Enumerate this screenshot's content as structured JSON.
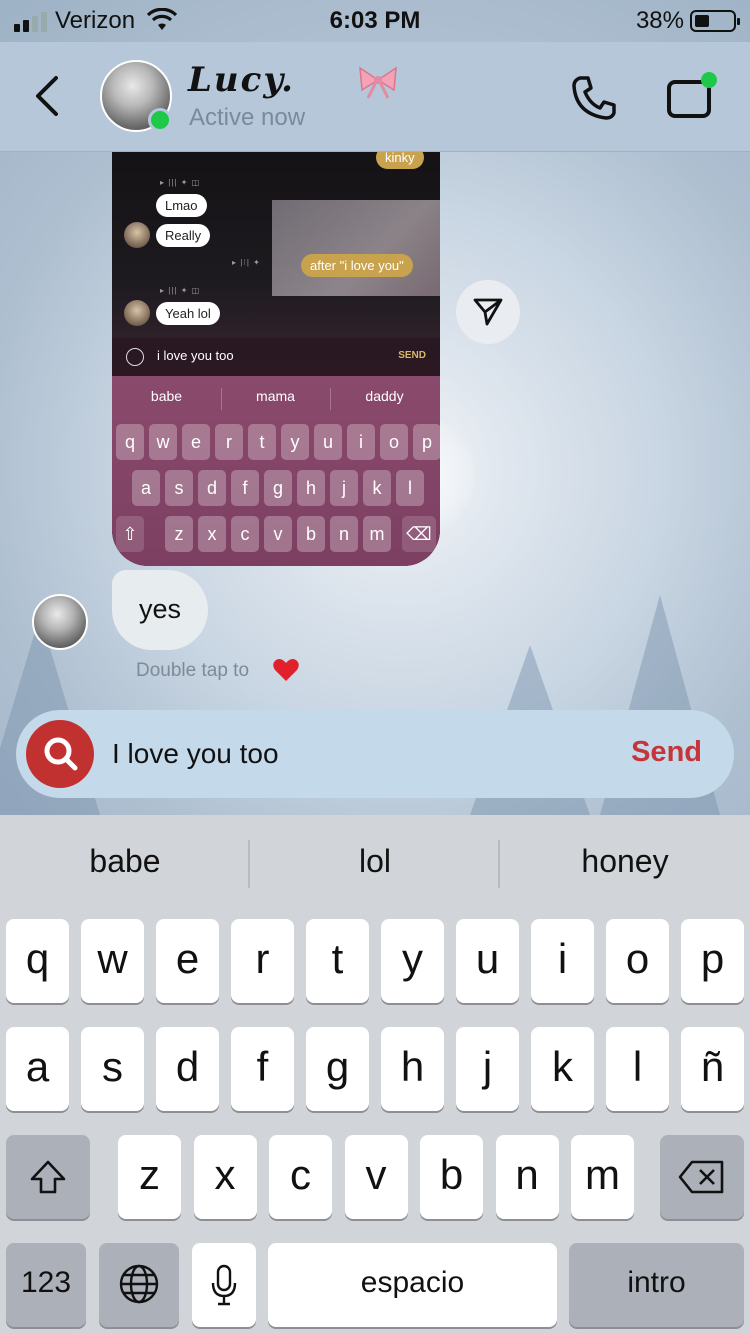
{
  "status_bar": {
    "carrier": "Verizon",
    "time": "6:03 PM",
    "battery": "38%"
  },
  "header": {
    "name": "Lucy.",
    "subtitle": "Active now"
  },
  "shared_screenshot": {
    "messages": [
      {
        "text": "kinky",
        "style": "gold"
      },
      {
        "text": "Lmao",
        "style": "white"
      },
      {
        "text": "Really",
        "style": "white"
      },
      {
        "text": "after \"i love you\"",
        "style": "gold"
      },
      {
        "text": "Yeah lol",
        "style": "white"
      }
    ],
    "input_text": "i love you too",
    "send_label": "SEND",
    "suggestions": [
      "babe",
      "mama",
      "daddy"
    ],
    "rows": [
      [
        "q",
        "w",
        "e",
        "r",
        "t",
        "y",
        "u",
        "i",
        "o",
        "p"
      ],
      [
        "a",
        "s",
        "d",
        "f",
        "g",
        "h",
        "j",
        "k",
        "l"
      ],
      [
        "z",
        "x",
        "c",
        "v",
        "b",
        "n",
        "m"
      ]
    ]
  },
  "message": {
    "text": "yes",
    "hint": "Double tap to"
  },
  "composer": {
    "text": "I love you too",
    "send_label": "Send"
  },
  "keyboard": {
    "suggestions": [
      "babe",
      "lol",
      "honey"
    ],
    "row1": [
      "q",
      "w",
      "e",
      "r",
      "t",
      "y",
      "u",
      "i",
      "o",
      "p"
    ],
    "row2": [
      "a",
      "s",
      "d",
      "f",
      "g",
      "h",
      "j",
      "k",
      "l",
      "ñ"
    ],
    "row3": [
      "z",
      "x",
      "c",
      "v",
      "b",
      "n",
      "m"
    ],
    "numbers_label": "123",
    "space_label": "espacio",
    "return_label": "intro"
  },
  "colors": {
    "send_accent": "#c6353a",
    "search_button": "#c1312f",
    "online": "#1ec94a",
    "bubble_gold": "#c9a24e"
  }
}
